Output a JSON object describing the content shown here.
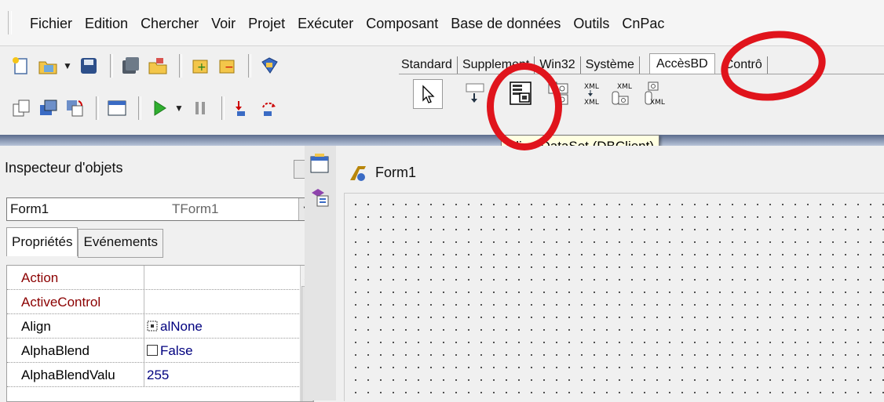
{
  "menu": [
    "Fichier",
    "Edition",
    "Chercher",
    "Voir",
    "Projet",
    "Exécuter",
    "Composant",
    "Base de données",
    "Outils",
    "CnPac"
  ],
  "palette": {
    "tabs": [
      "Standard",
      "Supplement",
      "Win32",
      "Système",
      "AccèsBD",
      "Contrô"
    ],
    "active_tab": "AccèsBD",
    "components": [
      "select-pointer",
      "datasource-icon",
      "clientdataset-icon",
      "dataset-provider-icon",
      "xml-transform-icon",
      "xml-transform-provider-icon",
      "xml-transform-client-icon"
    ]
  },
  "tooltip": "ClientDataSet (DBClient)",
  "inspector": {
    "title": "Inspecteur d'objets",
    "object_name": "Form1",
    "object_type": "TForm1",
    "tabs": [
      "Propriétés",
      "Evénements"
    ],
    "properties": [
      {
        "name": "Action",
        "value": "",
        "color": "#8b0000"
      },
      {
        "name": "ActiveControl",
        "value": "",
        "color": "#8b0000"
      },
      {
        "name": "Align",
        "value": "alNone",
        "color": "#111111"
      },
      {
        "name": "AlphaBlend",
        "value": "False",
        "color": "#111111"
      },
      {
        "name": "AlphaBlendValu",
        "value": "255",
        "color": "#111111"
      }
    ]
  },
  "form": {
    "title": "Form1"
  },
  "colors": {
    "annotation": "#e0141c",
    "tooltip_bg": "#ffffe1"
  }
}
